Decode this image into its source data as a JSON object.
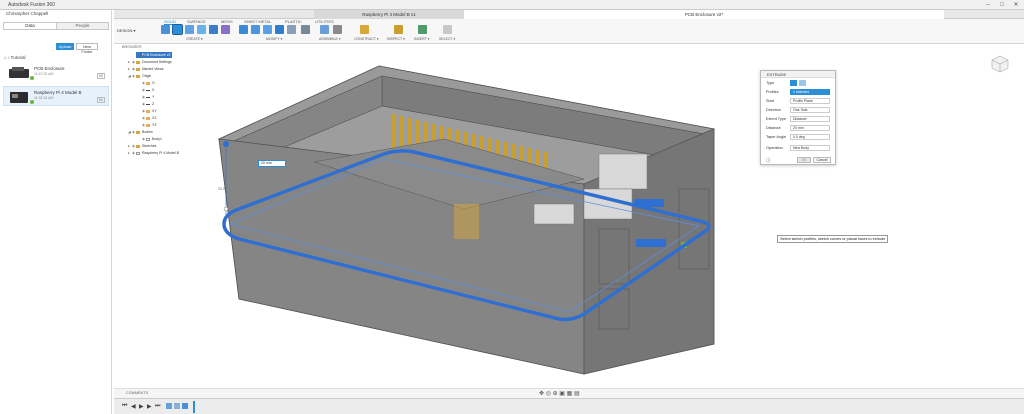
{
  "app": {
    "title": "Autodesk Fusion 360"
  },
  "left_panel": {
    "user": "Christopher Chappell",
    "tabs": [
      "Data",
      "People"
    ],
    "upload_label": "Upload",
    "new_folder_label": "New Folder",
    "breadcrumb": "Tutorial",
    "files": [
      {
        "name": "PCB Enclosure",
        "date": "11:47:20 AM",
        "version": "V2"
      },
      {
        "name": "Raspberry Pi 4 Model B",
        "date": "11:32:31 AM",
        "version": "V1"
      }
    ]
  },
  "tabs": [
    {
      "label": "Raspberry Pi 4 Model B v1"
    },
    {
      "label": "PCB Enclosure v2*"
    }
  ],
  "ribbon": {
    "workspace": "DESIGN ▾",
    "tabs": [
      "SOLID",
      "SURFACE",
      "MESH",
      "SHEET METAL",
      "PLASTIC",
      "UTILITIES"
    ],
    "groups": [
      "CREATE ▾",
      "MODIFY ▾",
      "ASSEMBLE ▾",
      "CONSTRUCT ▾",
      "INSPECT ▾",
      "INSERT ▾",
      "SELECT ▾"
    ]
  },
  "browser": {
    "header": "BROWSER",
    "items": [
      {
        "label": "PCB Enclosure v2",
        "highlight": true
      },
      {
        "label": "Document Settings"
      },
      {
        "label": "Named Views"
      },
      {
        "label": "Origin"
      },
      {
        "label": "O"
      },
      {
        "label": "X"
      },
      {
        "label": "Y"
      },
      {
        "label": "Z"
      },
      {
        "label": "XY"
      },
      {
        "label": "XZ"
      },
      {
        "label": "YZ"
      },
      {
        "label": "Bodies"
      },
      {
        "label": "Body1"
      },
      {
        "label": "Sketches"
      },
      {
        "label": "Raspberry Pi 4 Model B"
      }
    ]
  },
  "extrude": {
    "title": "EXTRUDE",
    "fields": [
      {
        "label": "Type",
        "value": ""
      },
      {
        "label": "Profiles",
        "value": "1 selected"
      },
      {
        "label": "Start",
        "value": "Profile Plane"
      },
      {
        "label": "Direction",
        "value": "One Side"
      },
      {
        "label": "Extent Type",
        "value": "Distance"
      },
      {
        "label": "Distance",
        "value": "20 mm"
      },
      {
        "label": "Taper Angle",
        "value": "0.0 deg"
      },
      {
        "label": "Operation",
        "value": "New Body"
      }
    ],
    "ok_label": "OK",
    "cancel_label": "Cancel"
  },
  "viewport": {
    "distance_input": "20 mm",
    "dim_label": "20.00",
    "tooltip": "Select sketch profiles, sketch curves or planar faces to extrude"
  },
  "footer": {
    "comments_label": "COMMENTS"
  },
  "colors": {
    "accent": "#2a8fd6",
    "selection": "#2f6fd1",
    "model": "#8c8c8c"
  }
}
